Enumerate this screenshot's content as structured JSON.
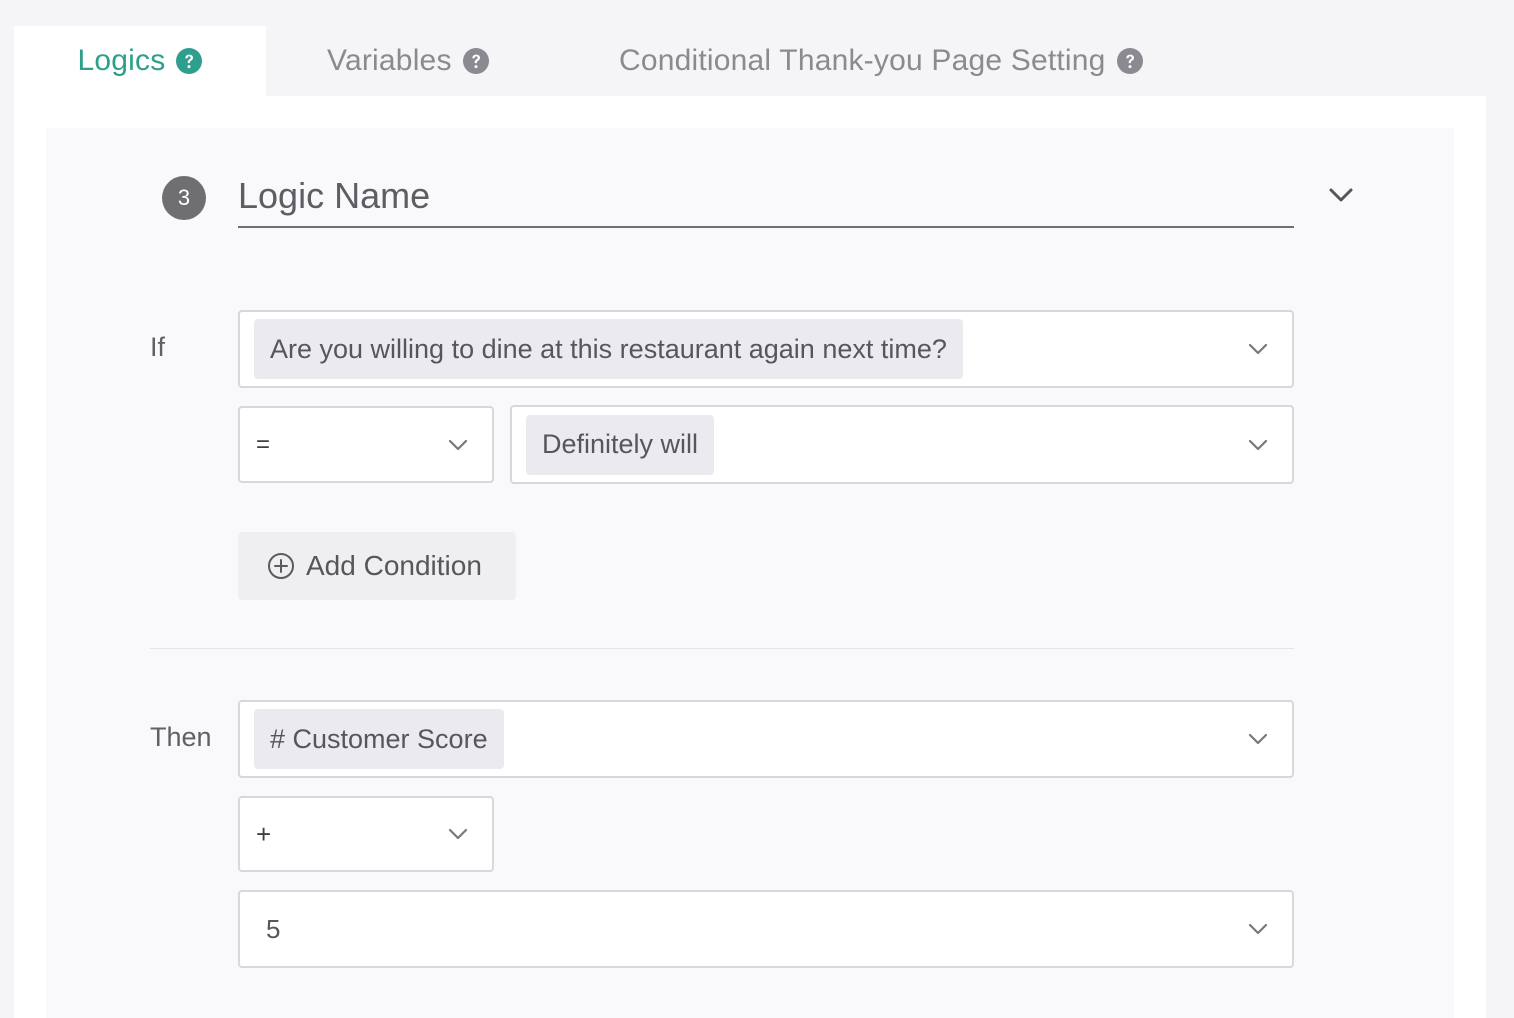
{
  "tabs": [
    {
      "label": "Logics",
      "active": true,
      "icon": "help-circle-icon"
    },
    {
      "label": "Variables",
      "active": false,
      "icon": "help-circle-icon"
    },
    {
      "label": "Conditional Thank-you Page Setting",
      "active": false,
      "icon": "help-circle-icon"
    }
  ],
  "logic": {
    "step_number": "3",
    "name_placeholder": "Logic Name"
  },
  "if_section": {
    "label": "If",
    "question": "Are you willing to dine at this restaurant again next time?",
    "operator": "=",
    "answer": "Definitely will",
    "add_condition_label": "Add Condition"
  },
  "then_section": {
    "label": "Then",
    "variable": "# Customer Score",
    "operator": "+",
    "value": "5"
  },
  "colors": {
    "accent": "#2e9f8c",
    "inactive_tab": "#8a8a90",
    "badge": "#6f6f73",
    "border": "#d8d7dc"
  }
}
